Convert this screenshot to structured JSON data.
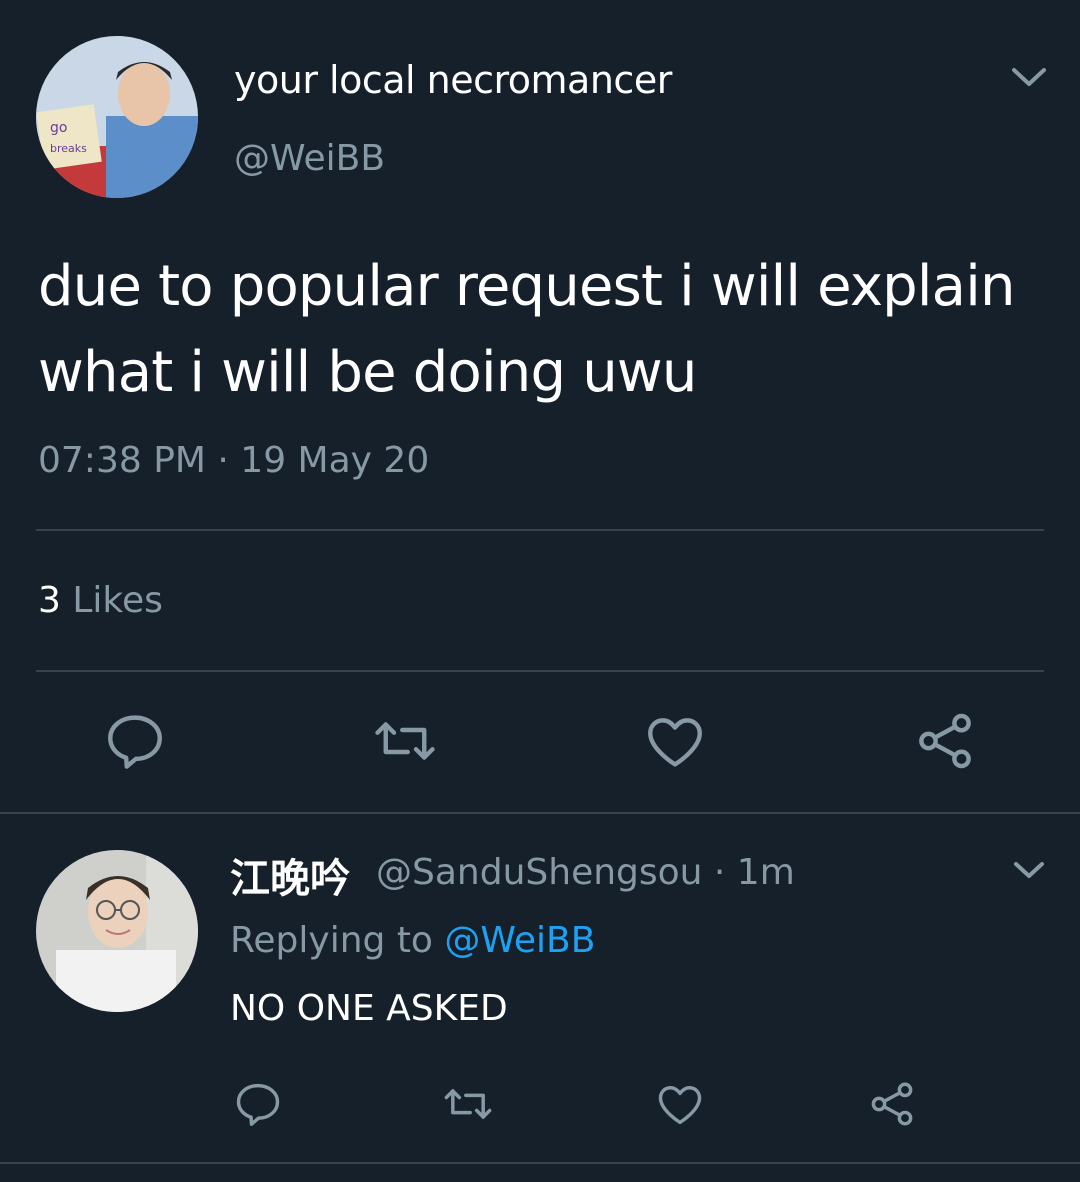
{
  "colors": {
    "background": "#15202b",
    "divider": "#38444d",
    "secondary_text": "#8899a6",
    "link": "#1da1f2",
    "icon": "#8899a6"
  },
  "main_tweet": {
    "display_name": "your local necromancer",
    "handle": "@WeiBB",
    "text": "due to popular request i will explain what i will be doing uwu",
    "timestamp": "07:38 PM · 19 May 20",
    "likes_count": "3",
    "likes_word": "Likes",
    "actions": [
      "reply-icon",
      "retweet-icon",
      "like-heart-icon",
      "share-icon"
    ]
  },
  "reply_tweet": {
    "display_name": "江晚吟",
    "handle_time": "@SanduShengsou · 1m",
    "replying_prefix": "Replying to",
    "replying_mention": "@WeiBB",
    "text": "NO ONE ASKED",
    "actions": [
      "reply-icon",
      "retweet-icon",
      "like-heart-icon",
      "share-icon"
    ]
  }
}
